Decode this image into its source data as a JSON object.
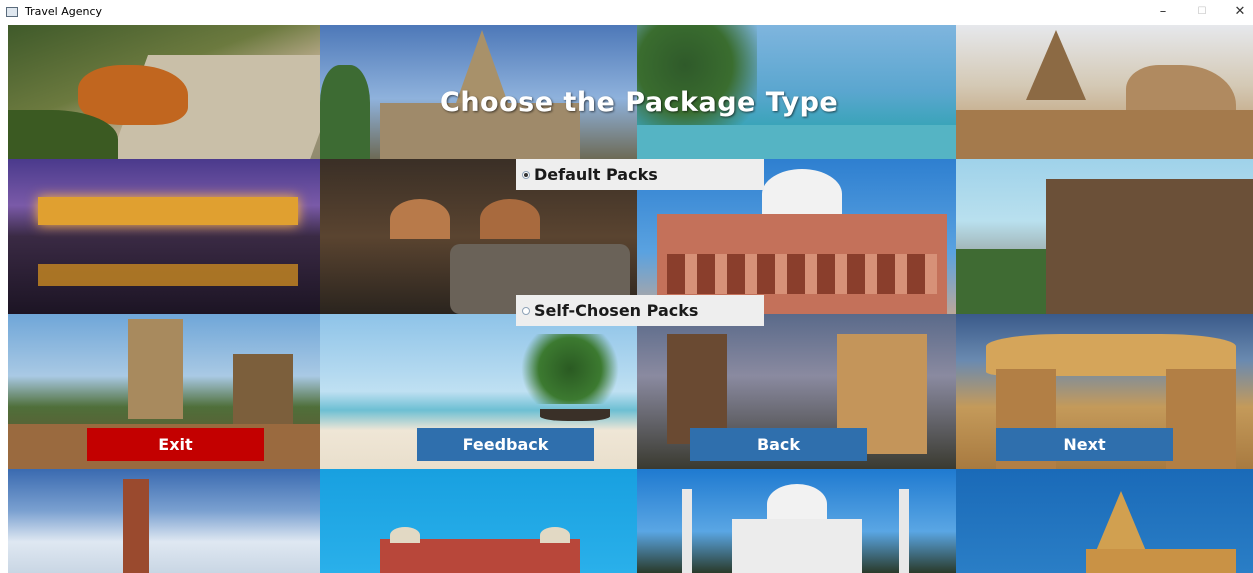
{
  "window": {
    "title": "Travel Agency",
    "minimize_glyph": "–",
    "maximize_glyph": "☐",
    "close_glyph": "✕"
  },
  "heading": "Choose the Package Type",
  "options": [
    {
      "label": "Default Packs",
      "selected": true
    },
    {
      "label": "Self-Chosen Packs",
      "selected": false
    }
  ],
  "buttons": {
    "exit": "Exit",
    "feedback": "Feedback",
    "back": "Back",
    "next": "Next"
  },
  "colors": {
    "exit_button": "#c30000",
    "nav_button": "#2f6fad",
    "radio_panel": "#eeeeee"
  },
  "tiles": [
    "tiger-on-road",
    "temple-tower",
    "beach-resort-pool",
    "shore-temple-nandi",
    "fort-lit-at-night",
    "cave-interior",
    "humayun-tomb",
    "stone-temple-ruins",
    "south-indian-gopuram",
    "palm-beach",
    "khajuraho-temples",
    "sandstone-rock-arch",
    "qutub-minar",
    "red-fort",
    "taj-mahal",
    "somnath-temple"
  ]
}
